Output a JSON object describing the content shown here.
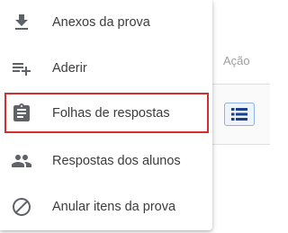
{
  "table": {
    "column_header_action": "Ação",
    "row_action_icon": "list-icon"
  },
  "menu": {
    "items": [
      {
        "label": "Anexos da prova",
        "icon": "download-icon"
      },
      {
        "label": "Aderir",
        "icon": "playlist-add-icon"
      },
      {
        "label": "Folhas de respostas",
        "icon": "assignment-icon",
        "highlighted": true
      },
      {
        "label": "Respostas dos alunos",
        "icon": "people-icon"
      },
      {
        "label": "Anular itens da prova",
        "icon": "block-icon"
      }
    ]
  },
  "colors": {
    "icon": "#5f6368",
    "highlight_border": "#d32f2f",
    "action_button_border": "#8fb2e8",
    "action_icon": "#1a3f8c"
  }
}
